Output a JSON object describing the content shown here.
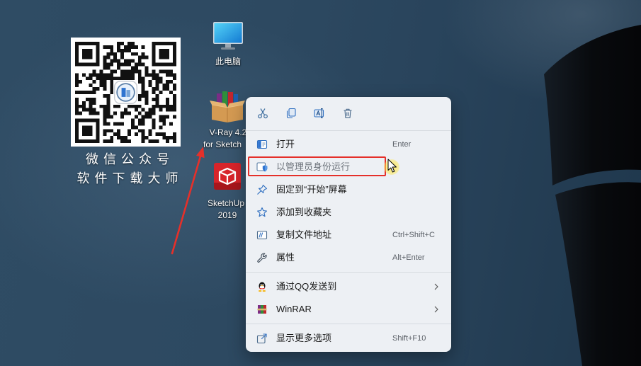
{
  "colors": {
    "desktop_background": "#2d4961",
    "menu_background": "#edf0f4",
    "accent_blue": "#2f6fc0",
    "annotation_red": "#e5302a",
    "cursor_highlight": "#ffe84a"
  },
  "desktop": {
    "qr_card": {
      "icon": "qr-code-icon",
      "caption_line1": "微信公众号",
      "caption_line2": "软件下载大师"
    },
    "icons": [
      {
        "icon": "this-pc-icon",
        "label_lines": [
          "此电脑"
        ]
      },
      {
        "icon": "winrar-archive-icon",
        "label_lines": [
          "V-Ray 4.2",
          "for Sketch"
        ]
      },
      {
        "icon": "sketchup-icon",
        "label_lines": [
          "SketchUp",
          "2019"
        ]
      }
    ]
  },
  "context_menu": {
    "toolbar": [
      {
        "icon": "cut-icon"
      },
      {
        "icon": "copy-icon"
      },
      {
        "icon": "rename-icon"
      },
      {
        "icon": "delete-icon"
      }
    ],
    "sections": [
      {
        "items": [
          {
            "icon": "open-icon",
            "label": "打开",
            "shortcut": "Enter"
          },
          {
            "icon": "run-as-admin-shield-icon",
            "label": "以管理员身份运行",
            "highlighted": true
          },
          {
            "icon": "pin-icon",
            "label": "固定到“开始”屏幕"
          },
          {
            "icon": "star-icon",
            "label": "添加到收藏夹"
          },
          {
            "icon": "copy-path-icon",
            "label": "复制文件地址",
            "shortcut": "Ctrl+Shift+C"
          },
          {
            "icon": "wrench-icon",
            "label": "属性",
            "shortcut": "Alt+Enter"
          }
        ]
      },
      {
        "items": [
          {
            "icon": "qq-icon",
            "label": "通过QQ发送到",
            "submenu_icon": "chevron-right-icon"
          },
          {
            "icon": "winrar-icon",
            "label": "WinRAR",
            "submenu_icon": "chevron-right-icon"
          }
        ]
      },
      {
        "items": [
          {
            "icon": "show-more-options-icon",
            "label": "显示更多选项",
            "shortcut": "Shift+F10"
          }
        ]
      }
    ]
  },
  "annotations": {
    "arrow_icon": "red-arrow-icon",
    "highlight_color": "#e5302a"
  },
  "cursor": {
    "icon": "mouse-pointer-icon"
  }
}
